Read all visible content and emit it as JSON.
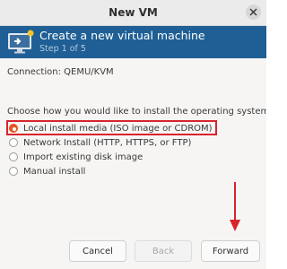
{
  "window": {
    "title": "New VM"
  },
  "header": {
    "title": "Create a new virtual machine",
    "step": "Step 1 of 5"
  },
  "connection": {
    "label": "Connection:",
    "value": "QEMU/KVM"
  },
  "install": {
    "prompt": "Choose how you would like to install the operating system",
    "options": [
      {
        "label": "Local install media (ISO image or CDROM)",
        "selected": true
      },
      {
        "label": "Network Install (HTTP, HTTPS, or FTP)",
        "selected": false
      },
      {
        "label": "Import existing disk image",
        "selected": false
      },
      {
        "label": "Manual install",
        "selected": false
      }
    ]
  },
  "buttons": {
    "cancel": "Cancel",
    "back": "Back",
    "forward": "Forward"
  },
  "colors": {
    "header_bg": "#1f5f95",
    "accent": "#e95420",
    "highlight": "#d9232d"
  },
  "icons": {
    "close": "close-icon",
    "header": "monitor-icon",
    "annotation": "arrow-down-icon"
  }
}
